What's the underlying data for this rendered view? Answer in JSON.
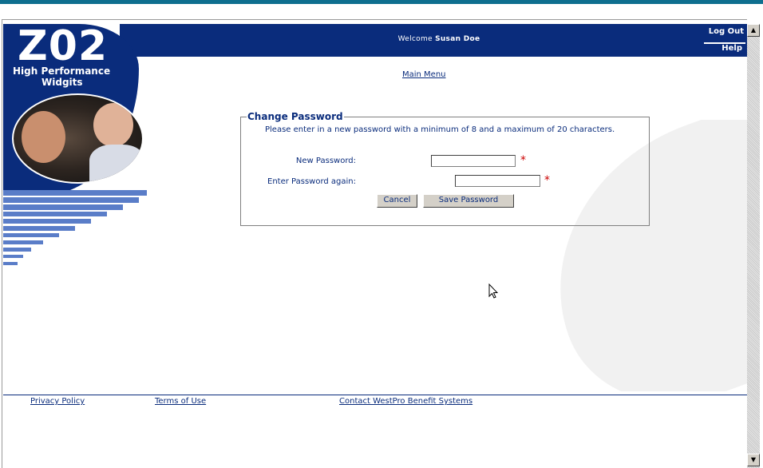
{
  "header": {
    "welcome_prefix": "Welcome",
    "user_name": "Susan Doe",
    "logout_label": "Log Out",
    "help_label": "Help"
  },
  "logo": {
    "brand": "Z02",
    "tagline_line1": "High Performance",
    "tagline_line2": "Widgits"
  },
  "nav": {
    "main_menu": "Main Menu"
  },
  "form": {
    "legend": "Change Password",
    "instructions": "Please enter in a new password with a minimum of 8 and a maximum of 20 characters.",
    "new_password_label": "New Password:",
    "confirm_password_label": "Enter Password again:",
    "new_password_value": "",
    "confirm_password_value": "",
    "required_marker": "*",
    "cancel_label": "Cancel",
    "save_label": "Save Password"
  },
  "footer": {
    "privacy": "Privacy Policy",
    "terms": "Terms of Use",
    "contact": "Contact WestPro Benefit Systems"
  },
  "colors": {
    "brand_navy": "#0a2c7c",
    "top_bar": "#0e6f8f",
    "required": "#cc0000"
  },
  "icons": {
    "scroll_up": "up-arrow-icon",
    "scroll_down": "down-arrow-icon",
    "cursor": "mouse-pointer-icon"
  }
}
